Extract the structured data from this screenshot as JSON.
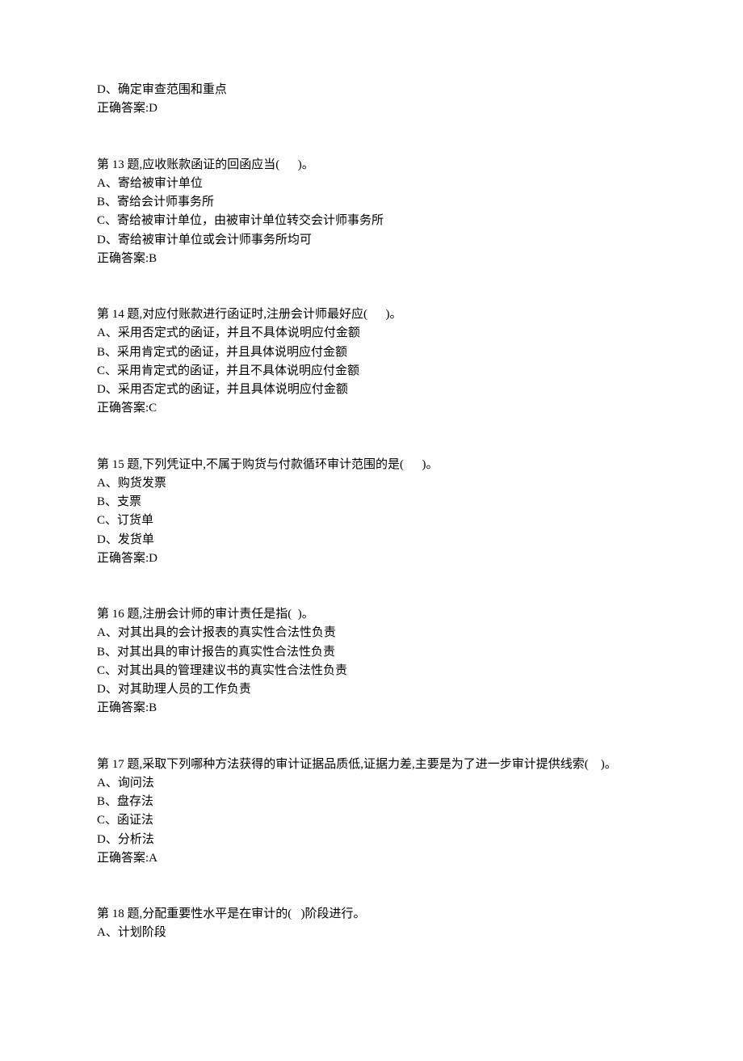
{
  "fragment_before": {
    "option_d": "D、确定审查范围和重点",
    "answer": "正确答案:D"
  },
  "questions": [
    {
      "stem": "第 13 题,应收账款函证的回函应当(      )。",
      "options": [
        "A、寄给被审计单位",
        "B、寄给会计师事务所",
        "C、寄给被审计单位，由被审计单位转交会计师事务所",
        "D、寄给被审计单位或会计师事务所均可"
      ],
      "answer": "正确答案:B"
    },
    {
      "stem": "第 14 题,对应付账款进行函证时,注册会计师最好应(      )。",
      "options": [
        "A、采用否定式的函证，并且不具体说明应付金额",
        "B、采用肯定式的函证，并且具体说明应付金额",
        "C、采用肯定式的函证，并且不具体说明应付金额",
        "D、采用否定式的函证，并且具体说明应付金额"
      ],
      "answer": "正确答案:C"
    },
    {
      "stem": "第 15 题,下列凭证中,不属于购货与付款循环审计范围的是(      )。",
      "options": [
        "A、购货发票",
        "B、支票",
        "C、订货单",
        "D、发货单"
      ],
      "answer": "正确答案:D"
    },
    {
      "stem": "第 16 题,注册会计师的审计责任是指(  )。",
      "options": [
        "A、对其出具的会计报表的真实性合法性负责",
        "B、对其出具的审计报告的真实性合法性负责",
        "C、对其出具的管理建议书的真实性合法性负责",
        "D、对其助理人员的工作负责"
      ],
      "answer": "正确答案:B"
    },
    {
      "stem": "第 17 题,采取下列哪种方法获得的审计证据品质低,证据力差,主要是为了进一步审计提供线索(    )。",
      "options": [
        "A、询问法",
        "B、盘存法",
        "C、函证法",
        "D、分析法"
      ],
      "answer": "正确答案:A"
    },
    {
      "stem": "第 18 题,分配重要性水平是在审计的(   )阶段进行。",
      "options": [
        "A、计划阶段"
      ],
      "answer": ""
    }
  ]
}
